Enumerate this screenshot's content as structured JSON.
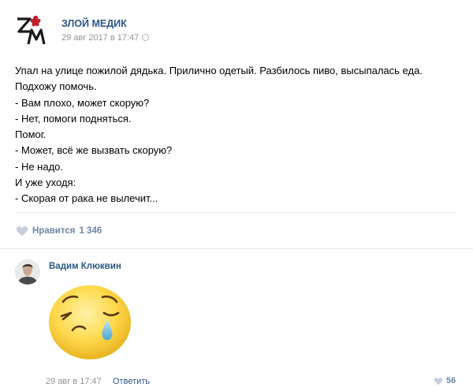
{
  "post": {
    "author": "ЗЛОЙ МЕДИК",
    "date": "29 авг 2017 в 17:47",
    "logo_icon": "zm-logo-icon",
    "lines": [
      "Упал на улице пожилой дядька. Прилично одетый. Разбилось пиво, высыпалась еда.",
      "Подхожу помочь.",
      "- Вам плохо, может скорую?",
      "- Нет, помоги подняться.",
      "Помог.",
      "- Может, всё же вызвать скорую?",
      "- Не надо.",
      "И уже уходя:",
      "- Скорая от рака не вылечит..."
    ],
    "likes_label": "Нравится",
    "likes_count": "1 346"
  },
  "comment": {
    "author": "Вадим Клюквин",
    "sticker": "crying-emoji-sticker",
    "date": "29 авг в 17:47",
    "reply_label": "Ответить",
    "likes_count": "56"
  },
  "colors": {
    "link": "#2a5885",
    "muted": "#939393",
    "like": "#6b86a4",
    "logo_red": "#c0202a",
    "sticker_yellow": "#ffd84a"
  }
}
